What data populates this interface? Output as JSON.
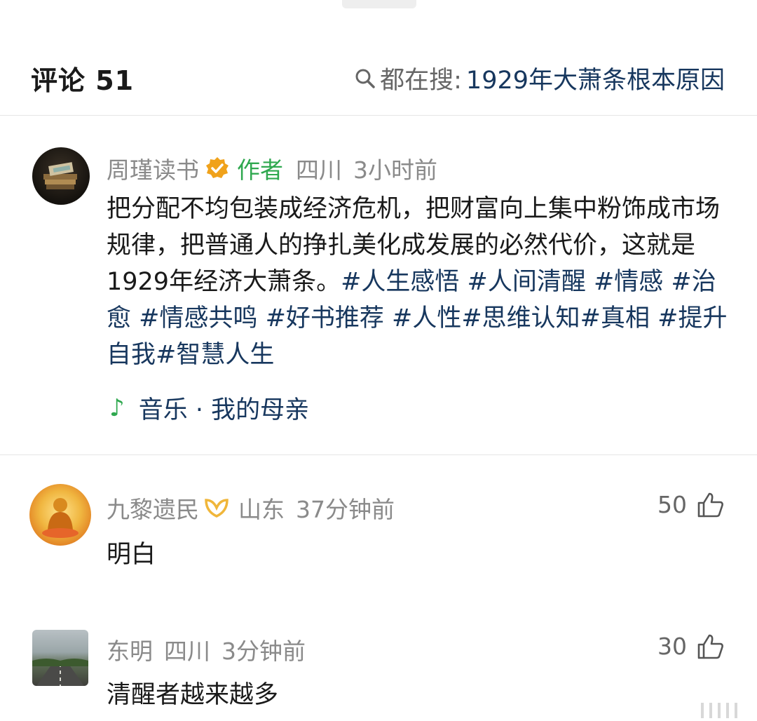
{
  "header": {
    "title": "评论 51",
    "search_prefix": "都在搜:",
    "search_term": "1929年大萧条根本原因"
  },
  "author_comment": {
    "name": "周瑾读书",
    "tag": "作者",
    "location": "四川",
    "time": "3小时前",
    "text_plain": "把分配不均包装成经济危机，把财富向上集中粉饰成市场规律，把普通人的挣扎美化成发展的必然代价，这就是1929年经济大萧条。",
    "text_tags": "#人生感悟 #人间清醒 #情感 #治愈 #情感共鸣 #好书推荐 #人性#思维认知#真相 #提升自我#智慧人生",
    "music": "音乐 · 我的母亲"
  },
  "comments": [
    {
      "name": "九黎遗民",
      "location": "山东",
      "time": "37分钟前",
      "text": "明白",
      "likes": "50"
    },
    {
      "name": "东明",
      "location": "四川",
      "time": "3分钟前",
      "text": "清醒者越来越多",
      "likes": "30"
    }
  ],
  "icons": {
    "verified": "verified-badge-icon",
    "vip": "vip-badge-icon",
    "like": "thumbs-up-icon",
    "search": "search-icon",
    "music": "music-note-icon"
  },
  "colors": {
    "link": "#17375e",
    "author_tag": "#2fa84f",
    "meta": "#8a8a8a",
    "verified": "#f0a21b"
  }
}
